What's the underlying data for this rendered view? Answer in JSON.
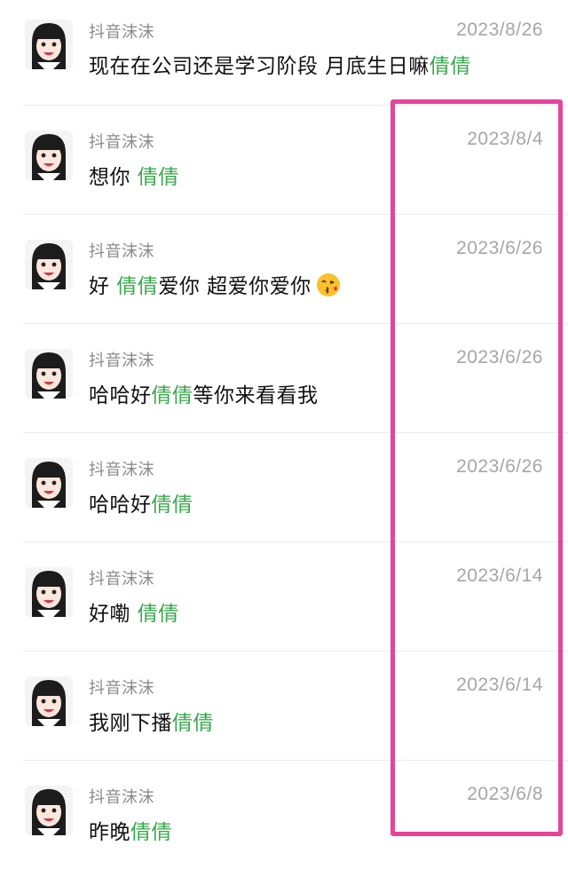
{
  "messages": [
    {
      "sender": "抖音沫沫",
      "date": "2023/8/26",
      "parts": [
        "现在在公司还是学习阶段 月底生日嘛",
        "倩倩",
        ""
      ]
    },
    {
      "sender": "抖音沫沫",
      "date": "2023/8/4",
      "parts": [
        "想你 ",
        "倩倩",
        ""
      ]
    },
    {
      "sender": "抖音沫沫",
      "date": "2023/6/26",
      "parts": [
        "好 ",
        "倩倩",
        "爱你 超爱你爱你"
      ],
      "emoji": "kissing-face-emoji"
    },
    {
      "sender": "抖音沫沫",
      "date": "2023/6/26",
      "parts": [
        "哈哈好",
        "倩倩",
        "等你来看看我"
      ]
    },
    {
      "sender": "抖音沫沫",
      "date": "2023/6/26",
      "parts": [
        "哈哈好",
        "倩倩",
        ""
      ]
    },
    {
      "sender": "抖音沫沫",
      "date": "2023/6/14",
      "parts": [
        "好嘞 ",
        "倩倩",
        ""
      ]
    },
    {
      "sender": "抖音沫沫",
      "date": "2023/6/14",
      "parts": [
        "我刚下播",
        "倩倩",
        ""
      ]
    },
    {
      "sender": "抖音沫沫",
      "date": "2023/6/8",
      "parts": [
        "昨晚",
        "倩倩",
        ""
      ]
    }
  ],
  "colors": {
    "highlight_name": "#3aa84e",
    "annotation_box": "#e6449a",
    "date_text": "#a6a6a6",
    "sender_text": "#8a8a8a"
  }
}
